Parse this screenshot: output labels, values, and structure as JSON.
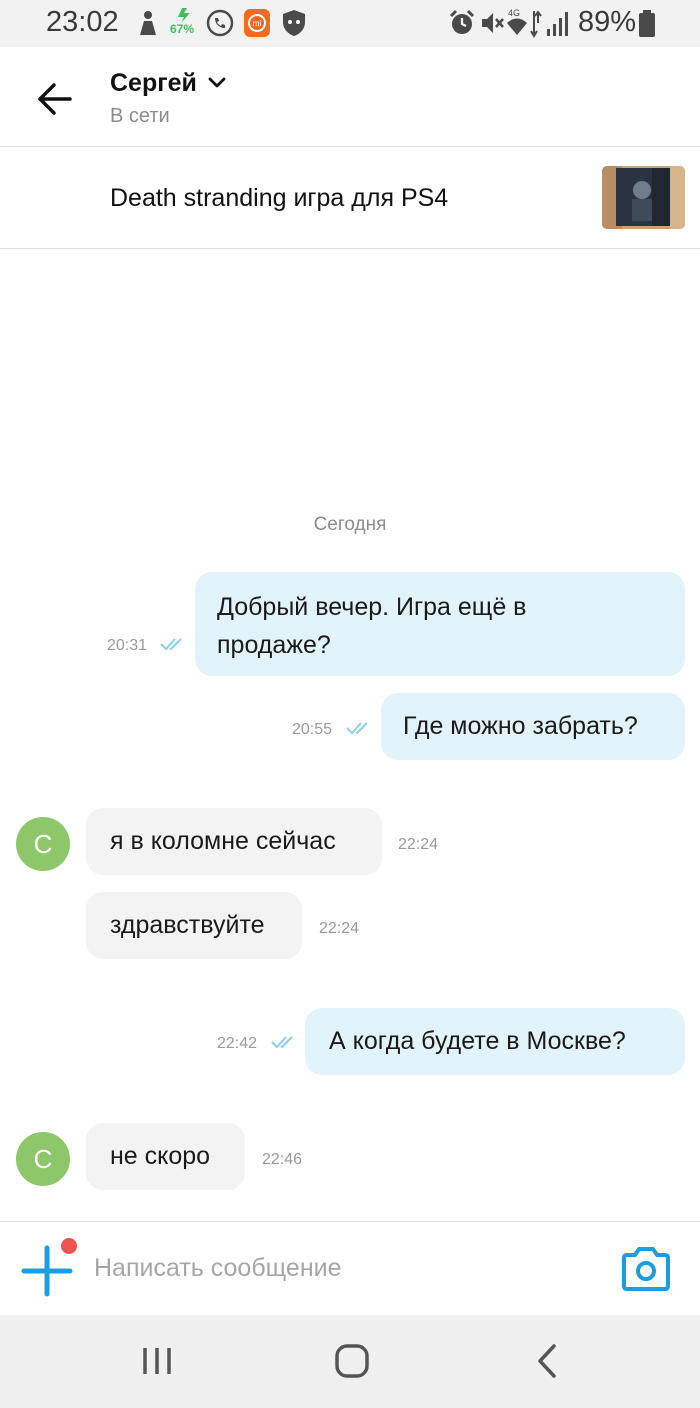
{
  "status_bar": {
    "time": "23:02",
    "battery_percent": "89%",
    "app_icon_badge": "67%"
  },
  "header": {
    "contact_name": "Сергей",
    "contact_status": "В сети"
  },
  "listing": {
    "title": "Death stranding игра для PS4"
  },
  "chat": {
    "date_separator": "Сегодня",
    "messages": [
      {
        "direction": "out",
        "lines": [
          "Добрый вечер. Игра ещё в",
          "продаже?"
        ],
        "time": "20:31",
        "read": true
      },
      {
        "direction": "out",
        "lines": [
          "Где можно забрать?"
        ],
        "time": "20:55",
        "read": true
      },
      {
        "direction": "in",
        "lines": [
          "я в коломне сейчас"
        ],
        "time": "22:24",
        "avatar_letter": "С"
      },
      {
        "direction": "in",
        "lines": [
          "здравствуйте"
        ],
        "time": "22:24"
      },
      {
        "direction": "out",
        "lines": [
          "А когда будете в Москве?"
        ],
        "time": "22:42",
        "read": true
      },
      {
        "direction": "in",
        "lines": [
          "не скоро"
        ],
        "time": "22:46",
        "avatar_letter": "С"
      }
    ]
  },
  "composer": {
    "placeholder": "Написать сообщение",
    "value": ""
  },
  "colors": {
    "accent": "#1e9ddb",
    "outgoing_bubble": "#e3f3fb",
    "incoming_bubble": "#f3f3f3",
    "avatar": "#8dc76a",
    "notification_dot": "#ef5350",
    "read_ticks": "#8fcdea"
  }
}
